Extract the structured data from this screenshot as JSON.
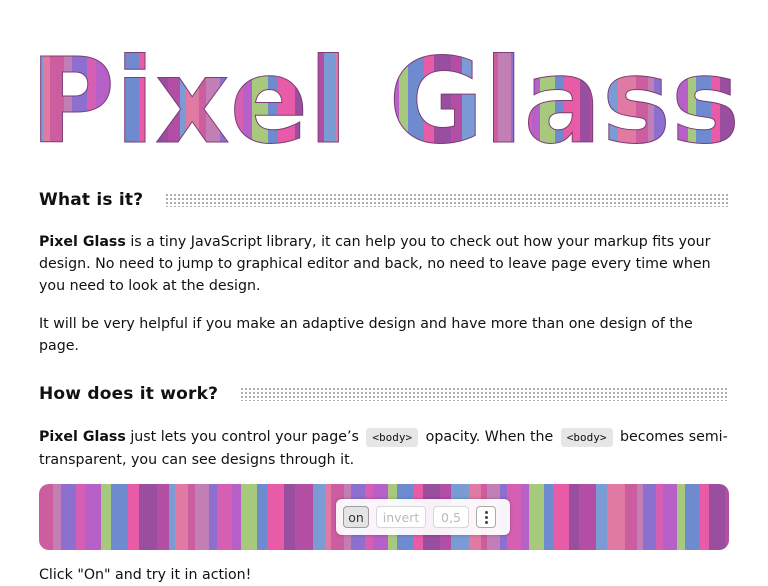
{
  "logo": {
    "text": "Pixel Glass"
  },
  "sections": {
    "what": {
      "heading": "What is it?",
      "p1_bold": "Pixel Glass",
      "p1_rest": " is a tiny JavaScript library, it can help you to check out how your markup fits your design. No need to jump to graphical editor and back, no need to leave page every time when you need to look at the design.",
      "p2": "It will be very helpful if you make an adaptive design and have more than one design of the page."
    },
    "how": {
      "heading": "How does it work?",
      "p_bold": "Pixel Glass",
      "p_part1": " just lets you control your page’s ",
      "code": "<body>",
      "p_part2": " opacity. When the ",
      "p_part3": " becomes semi-transparent, you can see designs through it."
    }
  },
  "toolbar": {
    "on_label": "on",
    "invert_label": "invert",
    "opacity_value": "0,5",
    "menu_icon": "kebab-menu-icon"
  },
  "footer_text": "Click \"On\" and try it in action!",
  "colors": {
    "stripes": [
      "#b24ea4",
      "#8c6fcf",
      "#e85ba6",
      "#cc5d9f",
      "#a7c97e",
      "#7a9bd3",
      "#d45fb3",
      "#9a4ea0",
      "#c27fb6",
      "#6f8bd0",
      "#e07aa3",
      "#b760c8"
    ]
  }
}
